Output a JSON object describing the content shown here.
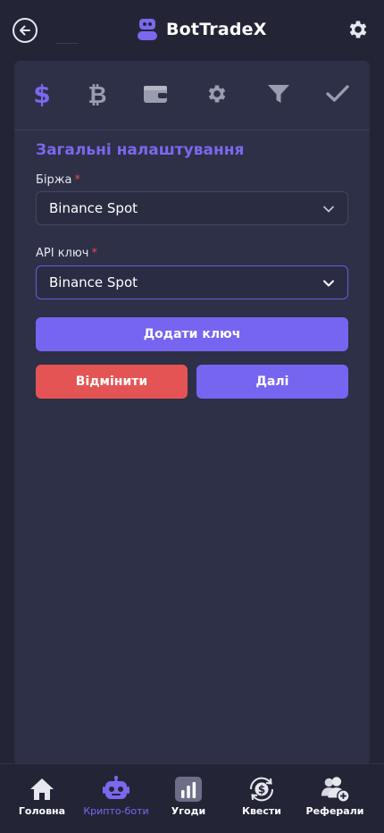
{
  "header": {
    "brand_name": "BotTradeX",
    "icons": [
      "back-arrow-icon",
      "robot-logo-icon",
      "gear-icon"
    ]
  },
  "steps": [
    {
      "icon": "dollar-icon",
      "active": true
    },
    {
      "icon": "bitcoin-icon",
      "active": false
    },
    {
      "icon": "wallet-icon",
      "active": false
    },
    {
      "icon": "gear-icon",
      "active": false
    },
    {
      "icon": "filter-icon",
      "active": false
    },
    {
      "icon": "check-icon",
      "active": false
    }
  ],
  "form": {
    "section_title": "Загальні налаштування",
    "exchange": {
      "label": "Біржа",
      "required_mark": "*",
      "value": "Binance Spot"
    },
    "api_key": {
      "label": "API ключ",
      "required_mark": "*",
      "value": "Binance Spot"
    },
    "add_key_label": "Додати ключ",
    "cancel_label": "Відмінити",
    "next_label": "Далі"
  },
  "nav": [
    {
      "label": "Головна",
      "icon": "home-icon",
      "active": false
    },
    {
      "label": "Крипто-боти",
      "icon": "robot-icon",
      "active": true
    },
    {
      "label": "Угоди",
      "icon": "bar-chart-icon",
      "active": false
    },
    {
      "label": "Квести",
      "icon": "coin-cycle-icon",
      "active": false
    },
    {
      "label": "Реферали",
      "icon": "add-user-icon",
      "active": false
    }
  ],
  "colors": {
    "background": "#232536",
    "card": "#2d3046",
    "accent": "#7565f0",
    "danger": "#e55454",
    "inactive_icon": "#9a9cb0"
  }
}
